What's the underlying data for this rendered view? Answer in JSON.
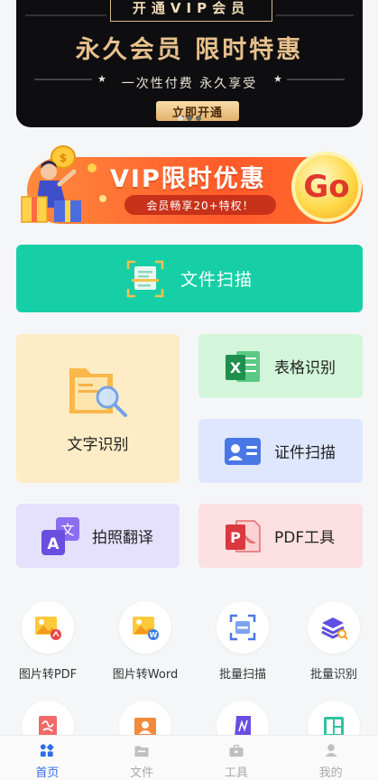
{
  "top_banner": {
    "title": "开通VIP会员",
    "headline": "永久会员 限时特惠",
    "subtitle": "一次性付费 永久享受",
    "button": "立即开通"
  },
  "vip_banner": {
    "title": "VIP限时优惠",
    "pill": "会员畅享20+特权！",
    "go": "Go"
  },
  "scan": {
    "label": "文件扫描"
  },
  "cards": {
    "text_recognition": "文字识别",
    "table_recognition": "表格识别",
    "id_scan": "证件扫描",
    "photo_translate": "拍照翻译",
    "pdf_tools": "PDF工具"
  },
  "tools": [
    {
      "label": "图片转PDF",
      "icon": "image-to-pdf-icon"
    },
    {
      "label": "图片转Word",
      "icon": "image-to-word-icon"
    },
    {
      "label": "批量扫描",
      "icon": "batch-scan-icon"
    },
    {
      "label": "批量识别",
      "icon": "batch-recognize-icon"
    }
  ],
  "bottom_nav": {
    "items": [
      {
        "label": "首页",
        "icon": "home-icon",
        "active": true
      },
      {
        "label": "文件",
        "icon": "folder-icon",
        "active": false
      },
      {
        "label": "工具",
        "icon": "toolbox-icon",
        "active": false
      },
      {
        "label": "我的",
        "icon": "profile-icon",
        "active": false
      }
    ]
  },
  "colors": {
    "accent": "#2f6ee6",
    "scan_green": "#17cfa6",
    "vip_orange": "#ff5a2a",
    "gold": "#e7c08c"
  }
}
